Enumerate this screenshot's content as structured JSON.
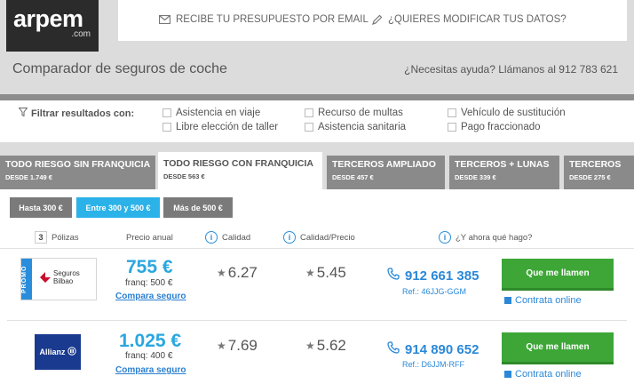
{
  "brand": {
    "name": "arpem",
    "suffix": ".com"
  },
  "header": {
    "email_link": "RECIBE TU PRESUPUESTO POR EMAIL",
    "modify_link": "¿QUIERES MODIFICAR TUS DATOS?",
    "subtitle": "Comparador de seguros de coche",
    "help": "¿Necesitas ayuda? Llámanos al 912 783 621"
  },
  "filters": {
    "label": "Filtrar resultados con:",
    "options": [
      "Asistencia en viaje",
      "Recurso de multas",
      "Vehículo de sustitución",
      "Libre elección de taller",
      "Asistencia sanitaria",
      "Pago fraccionado"
    ]
  },
  "tabs": [
    {
      "title": "TODO RIESGO SIN FRANQUICIA",
      "sub": "DESDE 1.749 €",
      "active": false
    },
    {
      "title": "TODO RIESGO CON FRANQUICIA",
      "sub": "DESDE 563 €",
      "active": true
    },
    {
      "title": "TERCEROS AMPLIADO",
      "sub": "DESDE 457 €",
      "active": false
    },
    {
      "title": "TERCEROS + LUNAS",
      "sub": "DESDE 339 €",
      "active": false
    },
    {
      "title": "TERCEROS",
      "sub": "DESDE 275 €",
      "active": false
    }
  ],
  "ranges": [
    {
      "label": "Hasta 300 €",
      "active": false
    },
    {
      "label": "Entre 300 y 500 €",
      "active": true
    },
    {
      "label": "Más de 500 €",
      "active": false
    }
  ],
  "table": {
    "count": "3",
    "col_polizas": "Pólizas",
    "col_precio": "Precio anual",
    "col_calidad": "Calidad",
    "col_calidad_precio": "Calidad/Precio",
    "col_help": "¿Y ahora qué hago?"
  },
  "results": [
    {
      "insurer": "Seguros Bilbao",
      "insurer_line1": "Seguros",
      "insurer_line2": "Bilbao",
      "promo": "PROMO",
      "price": "755 €",
      "franq": "franq: 500 €",
      "compara": "Compara seguro",
      "calidad": "6.27",
      "calidad_precio": "5.45",
      "phone": "912 661 385",
      "ref": "Ref.: 46JJG-GGM",
      "call_label": "Que me llamen",
      "online_label": "Contrata online"
    },
    {
      "insurer": "Allianz",
      "price": "1.025 €",
      "franq": "franq: 400 €",
      "compara": "Compara seguro",
      "calidad": "7.69",
      "calidad_precio": "5.62",
      "phone": "914 890 652",
      "ref": "Ref.: D6JJM-RFF",
      "call_label": "Que me llamen",
      "online_label": "Contrata online"
    }
  ],
  "colors": {
    "accent": "#2bb2e8",
    "green": "#3da637",
    "tab_gray": "#8a8a8a",
    "dark": "#2b2b2b"
  }
}
